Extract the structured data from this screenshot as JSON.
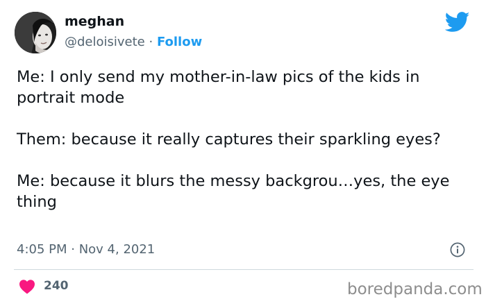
{
  "author": {
    "name": "meghan",
    "handle": "@deloisivete",
    "separator": " · ",
    "follow_label": "Follow"
  },
  "tweet": {
    "paragraphs": [
      "Me: I only send my mother-in-law pics of the kids in portrait mode",
      "Them: because it really captures their sparkling eyes?",
      "Me: because it blurs the messy backgrou…yes, the eye thing"
    ],
    "timestamp": "4:05 PM · Nov 4, 2021"
  },
  "engagement": {
    "likes": "240"
  },
  "watermark": "boredpanda.com",
  "icons": {
    "brand": "twitter-bird-icon",
    "info": "info-icon",
    "like": "heart-icon"
  },
  "colors": {
    "accent": "#1d9bf0",
    "heart": "#f91880",
    "muted": "#536471",
    "text": "#0f1419",
    "divider": "#cfd9de"
  }
}
